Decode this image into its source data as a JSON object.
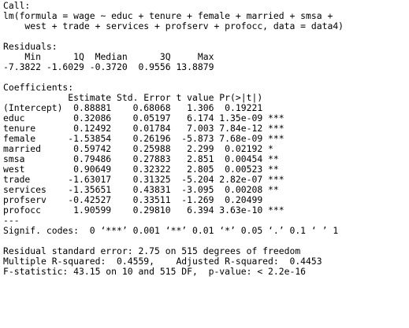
{
  "call": {
    "header": "Call:",
    "lines": [
      "lm(formula = wage ~ educ + tenure + female + married + smsa +",
      "    west + trade + services + profserv + profocc, data = data4)"
    ]
  },
  "residuals": {
    "header": "Residuals:",
    "labels_line": "    Min      1Q  Median      3Q     Max ",
    "values_line": "-7.3822 -1.6029 -0.3720  0.9556 13.8879 ",
    "stats": [
      {
        "name": "Min",
        "value": "-7.3822"
      },
      {
        "name": "1Q",
        "value": "-1.6029"
      },
      {
        "name": "Median",
        "value": "-0.3720"
      },
      {
        "name": "3Q",
        "value": "0.9556"
      },
      {
        "name": "Max",
        "value": "13.8879"
      }
    ]
  },
  "coefficients": {
    "header": "Coefficients:",
    "columns": [
      "Estimate",
      "Std. Error",
      "t value",
      "Pr(>|t|)"
    ],
    "header_line": "            Estimate Std. Error t value Pr(>|t|)    ",
    "rows": [
      {
        "term": "(Intercept)",
        "estimate": "0.88881",
        "std_error": "0.68068",
        "t_value": "1.306",
        "p_value": "0.19221",
        "signif": "",
        "line": "(Intercept)  0.88881    0.68068   1.306  0.19221    "
      },
      {
        "term": "educ",
        "estimate": "0.32086",
        "std_error": "0.05197",
        "t_value": "6.174",
        "p_value": "1.35e-09",
        "signif": "***",
        "line": "educ         0.32086    0.05197   6.174 1.35e-09 ***"
      },
      {
        "term": "tenure",
        "estimate": "0.12492",
        "std_error": "0.01784",
        "t_value": "7.003",
        "p_value": "7.84e-12",
        "signif": "***",
        "line": "tenure       0.12492    0.01784   7.003 7.84e-12 ***"
      },
      {
        "term": "female",
        "estimate": "-1.53854",
        "std_error": "0.26196",
        "t_value": "-5.873",
        "p_value": "7.68e-09",
        "signif": "***",
        "line": "female      -1.53854    0.26196  -5.873 7.68e-09 ***"
      },
      {
        "term": "married",
        "estimate": "0.59742",
        "std_error": "0.25988",
        "t_value": "2.299",
        "p_value": "0.02192",
        "signif": "*",
        "line": "married      0.59742    0.25988   2.299  0.02192 *  "
      },
      {
        "term": "smsa",
        "estimate": "0.79486",
        "std_error": "0.27883",
        "t_value": "2.851",
        "p_value": "0.00454",
        "signif": "**",
        "line": "smsa         0.79486    0.27883   2.851  0.00454 ** "
      },
      {
        "term": "west",
        "estimate": "0.90649",
        "std_error": "0.32322",
        "t_value": "2.805",
        "p_value": "0.00523",
        "signif": "**",
        "line": "west         0.90649    0.32322   2.805  0.00523 ** "
      },
      {
        "term": "trade",
        "estimate": "-1.63017",
        "std_error": "0.31325",
        "t_value": "-5.204",
        "p_value": "2.82e-07",
        "signif": "***",
        "line": "trade       -1.63017    0.31325  -5.204 2.82e-07 ***"
      },
      {
        "term": "services",
        "estimate": "-1.35651",
        "std_error": "0.43831",
        "t_value": "-3.095",
        "p_value": "0.00208",
        "signif": "**",
        "line": "services    -1.35651    0.43831  -3.095  0.00208 ** "
      },
      {
        "term": "profserv",
        "estimate": "-0.42527",
        "std_error": "0.33511",
        "t_value": "-1.269",
        "p_value": "0.20499",
        "signif": "",
        "line": "profserv    -0.42527    0.33511  -1.269  0.20499    "
      },
      {
        "term": "profocc",
        "estimate": "1.90599",
        "std_error": "0.29810",
        "t_value": "6.394",
        "p_value": "3.63e-10",
        "signif": "***",
        "line": "profocc      1.90599    0.29810   6.394 3.63e-10 ***"
      }
    ],
    "separator": "---",
    "signif_codes": "Signif. codes:  0 ‘***’ 0.001 ‘**’ 0.01 ‘*’ 0.05 ‘.’ 0.1 ‘ ’ 1"
  },
  "summary": {
    "residual_se": "Residual standard error: 2.75 on 515 degrees of freedom",
    "r_squared": "Multiple R-squared:  0.4559,\tAdjusted R-squared:  0.4453 ",
    "f_statistic": "F-statistic: 43.15 on 10 and 515 DF,  p-value: < 2.2e-16"
  }
}
